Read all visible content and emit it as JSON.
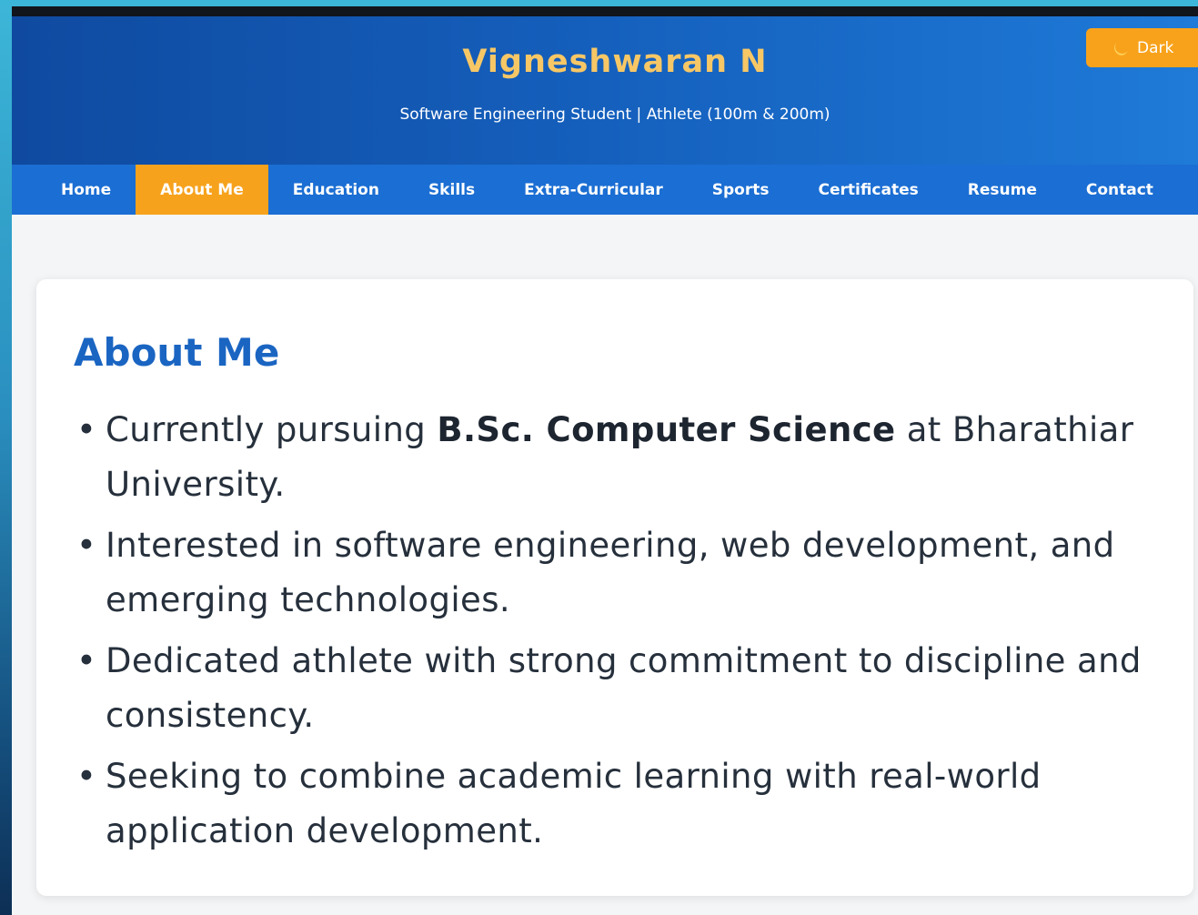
{
  "header": {
    "title": "Vigneshwaran N",
    "subtitle": "Software Engineering Student | Athlete (100m & 200m)",
    "theme_toggle": {
      "icon": "moon-icon",
      "label": "Dark"
    }
  },
  "nav": {
    "items": [
      {
        "label": "Home",
        "active": false
      },
      {
        "label": "About Me",
        "active": true
      },
      {
        "label": "Education",
        "active": false
      },
      {
        "label": "Skills",
        "active": false
      },
      {
        "label": "Extra-Curricular",
        "active": false
      },
      {
        "label": "Sports",
        "active": false
      },
      {
        "label": "Certificates",
        "active": false
      },
      {
        "label": "Resume",
        "active": false
      },
      {
        "label": "Contact",
        "active": false
      }
    ]
  },
  "about": {
    "title": "About Me",
    "items": [
      {
        "before": "Currently pursuing ",
        "bold": "B.Sc. Computer Science",
        "after": " at Bharathiar University."
      },
      {
        "before": "Interested in software engineering, web development, and emerging technologies.",
        "bold": "",
        "after": ""
      },
      {
        "before": "Dedicated athlete with strong commitment to discipline and consistency.",
        "bold": "",
        "after": ""
      },
      {
        "before": "Seeking to combine academic learning with real-world application development.",
        "bold": "",
        "after": ""
      }
    ]
  },
  "colors": {
    "header_gradient_start": "#0f4aa0",
    "header_gradient_end": "#1f7ad8",
    "nav_background": "#1b6ed3",
    "accent_orange": "#f7a21c",
    "title_gold": "#f7c766",
    "section_title_blue": "#1a65c2",
    "body_text": "#26303c"
  }
}
